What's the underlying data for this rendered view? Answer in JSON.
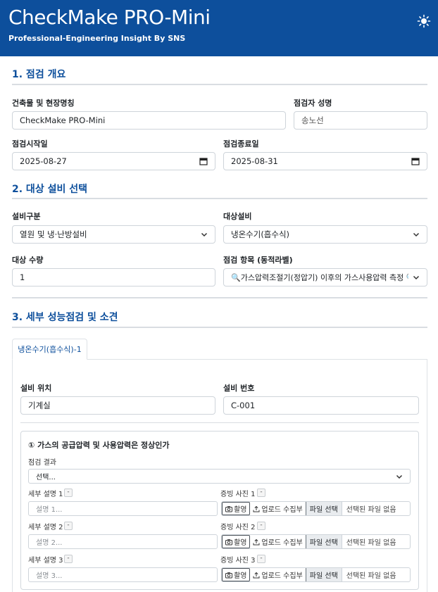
{
  "header": {
    "title": "CheckMake PRO-Mini",
    "subtitle": "Professional-Engineering Insight By SNS",
    "theme_icon": "sun-icon"
  },
  "overview": {
    "section_title": "1. 점검 개요",
    "building_label": "건축물 및 현장명칭",
    "building_value": "CheckMake PRO-Mini",
    "inspector_label": "점검자 성명",
    "inspector_value": "송노선",
    "start_label": "점검시작일",
    "start_value": "2025-08-27",
    "end_label": "점검종료일",
    "end_value": "2025-08-31"
  },
  "equipment": {
    "section_title": "2. 대상 설비 선택",
    "category_label": "설비구분",
    "category_value": "열원 및 냉·난방설비",
    "target_label": "대상설비",
    "target_value": "냉온수기(흡수식)",
    "quantity_label": "대상 수량",
    "quantity_value": "1",
    "items_label": "점검 항목 (동적라벨)",
    "items_value": "🔍가스압력조절기(정압기) 이후의 가스사용압력 측정 🔍가"
  },
  "detail": {
    "section_title": "3. 세부 성능점검 및 소견",
    "tab_label": "냉온수기(흡수식)-1",
    "location_label": "설비 위치",
    "location_value": "기계실",
    "number_label": "설비 번호",
    "number_value": "C-001",
    "card": {
      "title": "① 가스의 공급압력 및 사용압력은 정상인가",
      "result_label": "점검 결과",
      "result_value": "선택...",
      "rows": [
        {
          "desc_label": "세부 설명 1",
          "desc_placeholder": "설명 1...",
          "photo_label": "증빙 사진 1",
          "minus": "-"
        },
        {
          "desc_label": "세부 설명 2",
          "desc_placeholder": "설명 2...",
          "photo_label": "증빙 사진 2",
          "minus": "-"
        },
        {
          "desc_label": "세부 설명 3",
          "desc_placeholder": "설명 3...",
          "photo_label": "증빙 사진 3",
          "minus": "-"
        }
      ],
      "camera_label": "촬영",
      "upload_label": "업로드 수집부",
      "file_button": "파일 선택",
      "file_none": "선택된 파일 없음"
    }
  },
  "colors": {
    "header_bg": "#0d4f9c",
    "section_title": "#0d4f9c"
  }
}
